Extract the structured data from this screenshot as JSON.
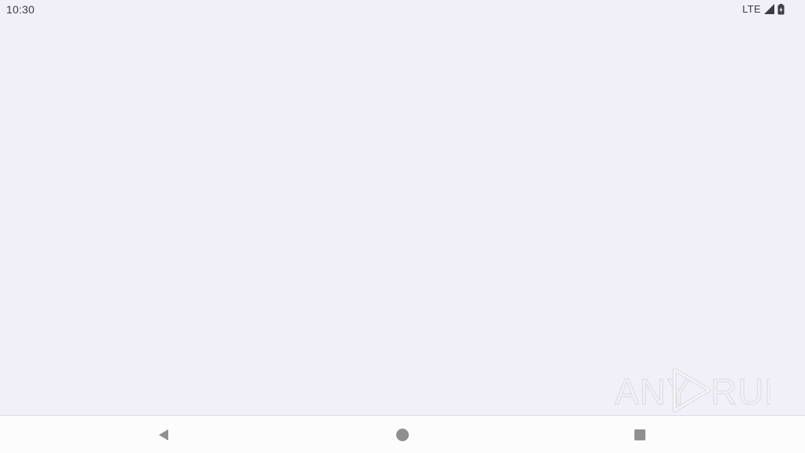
{
  "status_bar": {
    "time": "10:30",
    "network": "LTE",
    "icons": [
      "signal-icon",
      "battery-icon"
    ]
  },
  "watermark": {
    "left": "ANY",
    "right": "RUN"
  },
  "navigation": {
    "icons": [
      "back-icon",
      "home-icon",
      "recents-icon"
    ],
    "icon_color": "#8f8f8f"
  },
  "colors": {
    "background": "#f1f0f8",
    "status_text": "#3c3c44",
    "nav_background": "#fcfcfd",
    "watermark": "#e6e6ea"
  }
}
